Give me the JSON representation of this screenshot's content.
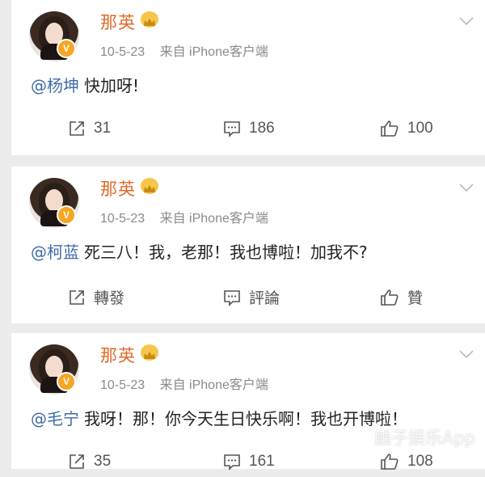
{
  "posts": [
    {
      "name": "那英",
      "date": "10-5-23",
      "source": "来自 iPhone客户端",
      "mention": "@杨坤",
      "text": "快加呀!",
      "repost": "31",
      "comment": "186",
      "like": "100"
    },
    {
      "name": "那英",
      "date": "10-5-23",
      "source": "来自 iPhone客户端",
      "mention": "@柯蓝",
      "text": "死三八！我，老那！我也博啦！加我不?",
      "repost": "轉發",
      "comment": "評論",
      "like": "贊"
    },
    {
      "name": "那英",
      "date": "10-5-23",
      "source": "来自 iPhone客户端",
      "mention": "@毛宁",
      "text": "我呀！那！你今天生日快乐啊！我也开博啦！",
      "repost": "35",
      "comment": "161",
      "like": "108"
    }
  ],
  "badge": "V",
  "watermark": "触子娱乐App",
  "colors": {
    "background": "#ececec",
    "name": "#e06a2a",
    "mention": "#3f6ba8",
    "verified": "#f5a623",
    "crown": "#f6c64a"
  },
  "icons": [
    "share-icon",
    "comment-icon",
    "thumbs-up-icon",
    "chevron-down-icon",
    "crown-icon",
    "verified-badge"
  ]
}
